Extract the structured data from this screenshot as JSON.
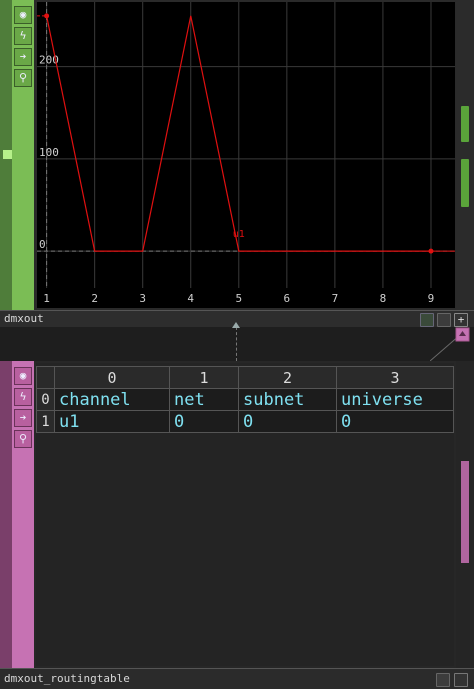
{
  "chop": {
    "name": "dmxout",
    "side_buttons": [
      "target-icon",
      "squiggle-icon",
      "arrow-right-icon",
      "bug-icon"
    ],
    "chart_data": {
      "type": "line",
      "x": [
        1,
        2,
        3,
        4,
        5,
        6,
        7,
        8,
        9
      ],
      "series": [
        {
          "name": "u1",
          "values": [
            255,
            0,
            0,
            255,
            0,
            0,
            0,
            0,
            0
          ],
          "color": "#e01010"
        }
      ],
      "xticks": [
        "1",
        "2",
        "3",
        "4",
        "5",
        "6",
        "7",
        "8",
        "9"
      ],
      "yticks": [
        "0",
        "100",
        "200"
      ],
      "ylim": [
        -40,
        270
      ],
      "xlim": [
        0.8,
        9.5
      ],
      "grid": true,
      "series_label": "u1"
    }
  },
  "dat": {
    "name": "dmxout_routingtable",
    "side_buttons": [
      "target-icon",
      "squiggle-icon",
      "arrow-right-icon",
      "bug-icon"
    ],
    "col_headers": [
      "0",
      "1",
      "2",
      "3"
    ],
    "rows": [
      {
        "index": "0",
        "cells": [
          "channel",
          "net",
          "subnet",
          "universe"
        ]
      },
      {
        "index": "1",
        "cells": [
          "u1",
          "0",
          "0",
          "0"
        ]
      }
    ]
  },
  "colors": {
    "chop_green": "#7bbd55",
    "dat_purple": "#c672b3",
    "curve_red": "#e01010",
    "text_cyan": "#7fe0f0"
  }
}
